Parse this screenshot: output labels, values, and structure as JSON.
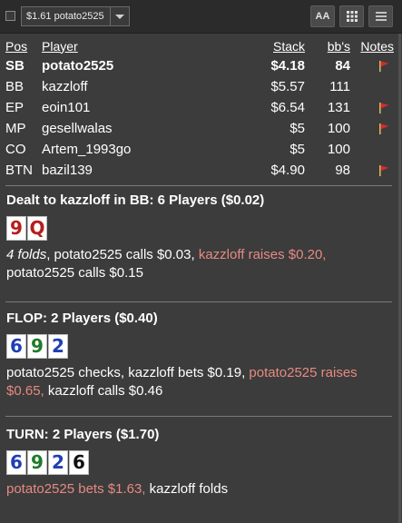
{
  "toolbar": {
    "select_value": "$1.61 potato2525",
    "text_size_label": "AA",
    "grid_icon": "grid-icon",
    "menu_icon": "menu-icon"
  },
  "colors": {
    "background": "#3c3c3c",
    "raise_text": "#e68a82",
    "flag": "#d12d2d",
    "card_red": "#b71c1c",
    "card_blue": "#1f3fb3",
    "card_green": "#1f7a2a",
    "card_black": "#111111"
  },
  "players_table": {
    "headers": {
      "pos": "Pos",
      "player": "Player",
      "stack": "Stack",
      "bbs": "bb's",
      "notes": "Notes"
    },
    "rows": [
      {
        "pos": "SB",
        "player": "potato2525",
        "stack": "$4.18",
        "bbs": "84",
        "flag": true,
        "hero": true
      },
      {
        "pos": "BB",
        "player": "kazzloff",
        "stack": "$5.57",
        "bbs": "111",
        "flag": false,
        "hero": false
      },
      {
        "pos": "EP",
        "player": "eoin101",
        "stack": "$6.54",
        "bbs": "131",
        "flag": true,
        "hero": false
      },
      {
        "pos": "MP",
        "player": "gesellwalas",
        "stack": "$5",
        "bbs": "100",
        "flag": true,
        "hero": false
      },
      {
        "pos": "CO",
        "player": "Artem_1993go",
        "stack": "$5",
        "bbs": "100",
        "flag": false,
        "hero": false
      },
      {
        "pos": "BTN",
        "player": "bazil139",
        "stack": "$4.90",
        "bbs": "98",
        "flag": true,
        "hero": false
      }
    ]
  },
  "preflop": {
    "title": "Dealt to kazzloff in BB: 6 Players ($0.02)",
    "cards": [
      {
        "rank": "9",
        "suit": "red"
      },
      {
        "rank": "Q",
        "suit": "red"
      }
    ],
    "folds": "4 folds",
    "a1": ", potato2525 calls $0.03, ",
    "a2": "kazzloff raises $0.20,",
    "a3": "potato2525 calls $0.15"
  },
  "flop": {
    "title": "FLOP: 2 Players ($0.40)",
    "cards": [
      {
        "rank": "6",
        "suit": "blue"
      },
      {
        "rank": "9",
        "suit": "green"
      },
      {
        "rank": "2",
        "suit": "blue"
      }
    ],
    "a1": "potato2525 checks, kazzloff bets $0.19, ",
    "a2": "potato2525 raises $0.65,",
    "a3": " kazzloff calls $0.46"
  },
  "turn": {
    "title": "TURN: 2 Players ($1.70)",
    "cards": [
      {
        "rank": "6",
        "suit": "blue"
      },
      {
        "rank": "9",
        "suit": "green"
      },
      {
        "rank": "2",
        "suit": "blue"
      },
      {
        "rank": "6",
        "suit": "black"
      }
    ],
    "a1": "potato2525 bets $1.63,",
    "a2": " kazzloff folds"
  }
}
